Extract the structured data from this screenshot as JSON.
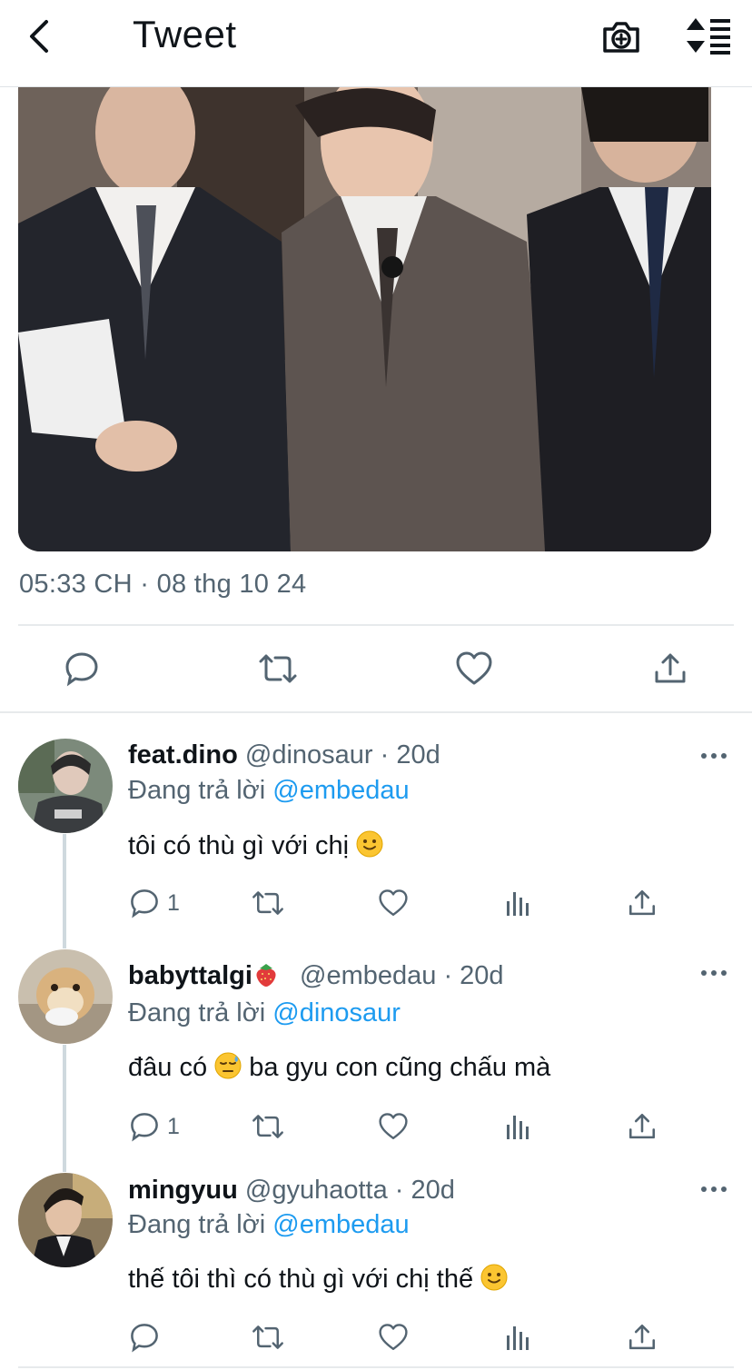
{
  "header": {
    "title": "Tweet",
    "back_icon": "chevron-left-icon",
    "camera_icon": "camera-plus-icon",
    "sort_icon": "sort-icon"
  },
  "tweet": {
    "media_description": "photo",
    "timestamp": "05:33 CH · 08 thg 10 24"
  },
  "colors": {
    "text": "#0f1419",
    "secondary": "#536471",
    "accent": "#1d9bf0",
    "divider": "#e7eaec"
  },
  "replies": [
    {
      "name": "feat.dino",
      "handle": "@dinosaur · 20d",
      "replying_prefix": "Đang trả lời",
      "replying_to": "@embedau",
      "text": "tôi có thù gì với chị",
      "text_emoji": "slightly-smiling-face",
      "reply_count": "1"
    },
    {
      "name": "babyttalgi",
      "name_emoji": "strawberry",
      "handle": "@embedau · 20d",
      "replying_prefix": "Đang trả lời",
      "replying_to": "@dinosaur",
      "text_before": "đâu có",
      "text_emoji": "downcast-sweat-face",
      "text_after": "ba gyu con cũng chấu mà",
      "reply_count": "1"
    },
    {
      "name": "mingyuu",
      "handle": "@gyuhaotta · 20d",
      "replying_prefix": "Đang trả lời",
      "replying_to": "@embedau",
      "text": "thế tôi thì có thù gì với chị thế",
      "text_emoji": "slightly-smiling-face",
      "reply_count": ""
    }
  ]
}
